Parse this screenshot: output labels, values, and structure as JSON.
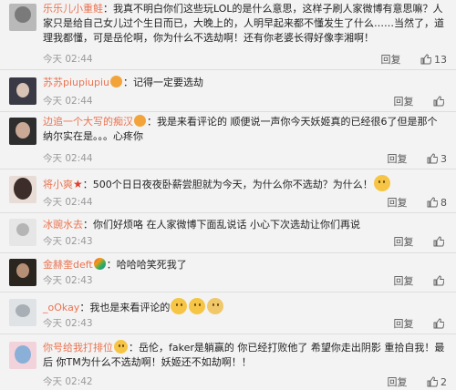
{
  "comments": [
    {
      "name": "乐乐儿小重鲑",
      "separator": "：",
      "text": "我真不明白你们这些玩LOL的是什么意思，这样子刷人家微博有意思嘛？人家只是给自己女儿过个生日而已，大晚上的，人明早起来都不懂发生了什么……当然了，道理我都懂，可是岳伦啊，你为什么不选劫啊！还有你老婆长得好像李湘啊！",
      "time": "今天 02:44",
      "reply": "回复",
      "likes": "13"
    },
    {
      "name": "苏苏piupiupiu",
      "separator": "：",
      "text": "记得一定要选劫",
      "time": "今天 02:44",
      "reply": "回复",
      "likes": ""
    },
    {
      "name": "边追一个大写的痴汉",
      "separator": "：",
      "text": "我是来看评论的 顺便说一声你今天妖姬真的已经很6了但是那个纳尔实在是。。。心疼你",
      "time": "今天 02:44",
      "reply": "回复",
      "likes": "3"
    },
    {
      "name": "将小爽",
      "separator": "：",
      "text": "500个日日夜夜卧薪尝胆就为今天，为什么你不选劫？为什么！",
      "time": "今天 02:44",
      "reply": "回复",
      "likes": "8"
    },
    {
      "name": "冰豌水去",
      "separator": "：",
      "text": "你们好烦咯 在人家微博下面乱说话 小心下次选劫让你们再说",
      "time": "今天 02:43",
      "reply": "回复",
      "likes": ""
    },
    {
      "name": "金赫奎deft",
      "separator": "：",
      "text": "哈哈哈笑死我了",
      "time": "今天 02:43",
      "reply": "回复",
      "likes": ""
    },
    {
      "name": "_oOkay",
      "separator": "：",
      "text": "我也是来看评论的",
      "time": "今天 02:43",
      "reply": "回复",
      "likes": ""
    },
    {
      "name": "你号给我打排位",
      "separator": "：",
      "text": "岳伦，faker是躺赢的 你已经打败他了 希望你走出阴影 重拾自我！最后 你TM为什么不选劫啊！妖姬还不如劫啊！！",
      "time": "今天 02:42",
      "reply": "回复",
      "likes": "2"
    }
  ],
  "colors": {
    "name": "#eb7350",
    "time": "#999999",
    "background": "#f3f3f3"
  }
}
